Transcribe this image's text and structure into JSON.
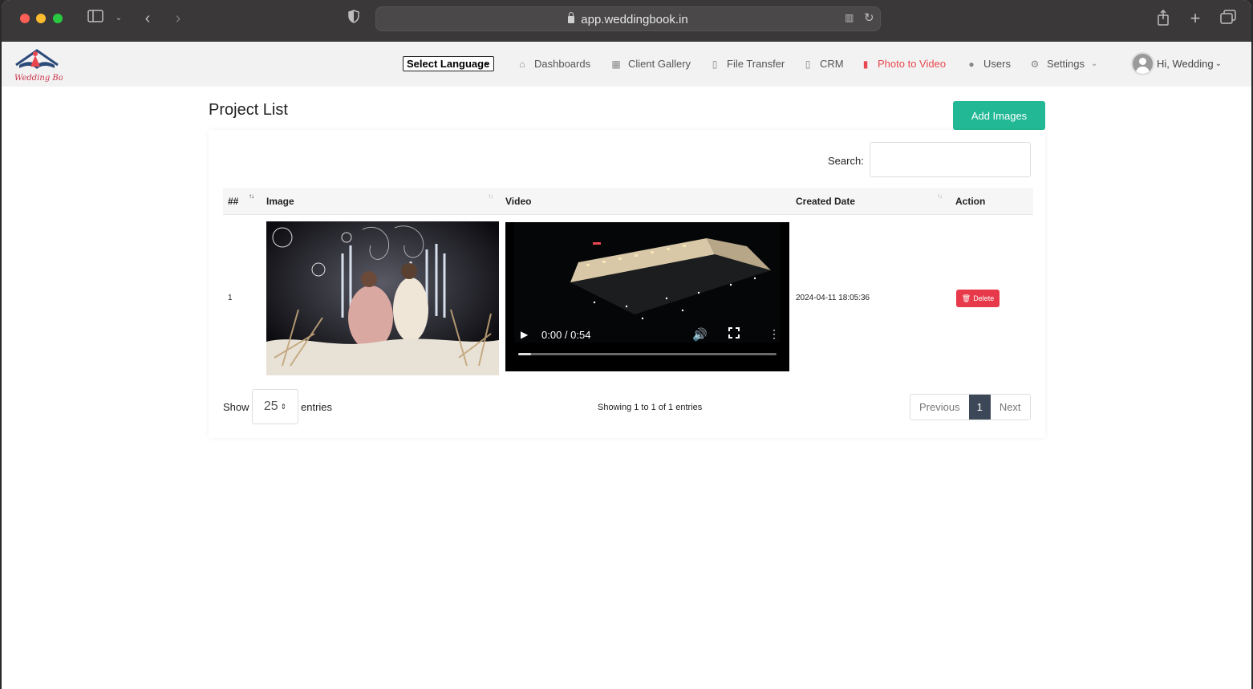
{
  "browser": {
    "url": "app.weddingbook.in"
  },
  "navbar": {
    "language_select": "Select Language",
    "items": [
      {
        "label": "Dashboards",
        "icon": "home-icon"
      },
      {
        "label": "Client Gallery",
        "icon": "calendar-icon"
      },
      {
        "label": "File Transfer",
        "icon": "file-icon"
      },
      {
        "label": "CRM",
        "icon": "file-icon"
      },
      {
        "label": "Photo to Video",
        "icon": "file-pdf-icon",
        "active": true
      },
      {
        "label": "Users",
        "icon": "user-icon"
      },
      {
        "label": "Settings",
        "icon": "gear-icon"
      }
    ],
    "user_greeting": "Hi, Wedding",
    "active_color": "#e8474f"
  },
  "page": {
    "title": "Project List",
    "add_button": "Add Images",
    "accent": "#22b895"
  },
  "table": {
    "search_label": "Search:",
    "headers": [
      "##",
      "Image",
      "Video",
      "Created Date",
      "Action"
    ],
    "rows": [
      {
        "num": "1",
        "video_time": "0:00 / 0:54",
        "video_progress": 0.05,
        "created_date": "2024-04-11 18:05:36",
        "action": "Delete"
      }
    ]
  },
  "footer": {
    "show_label": "Show",
    "page_size": "25",
    "entries_label": "entries",
    "info": "Showing 1 to 1 of 1 entries",
    "previous": "Previous",
    "current_page": "1",
    "next": "Next"
  }
}
